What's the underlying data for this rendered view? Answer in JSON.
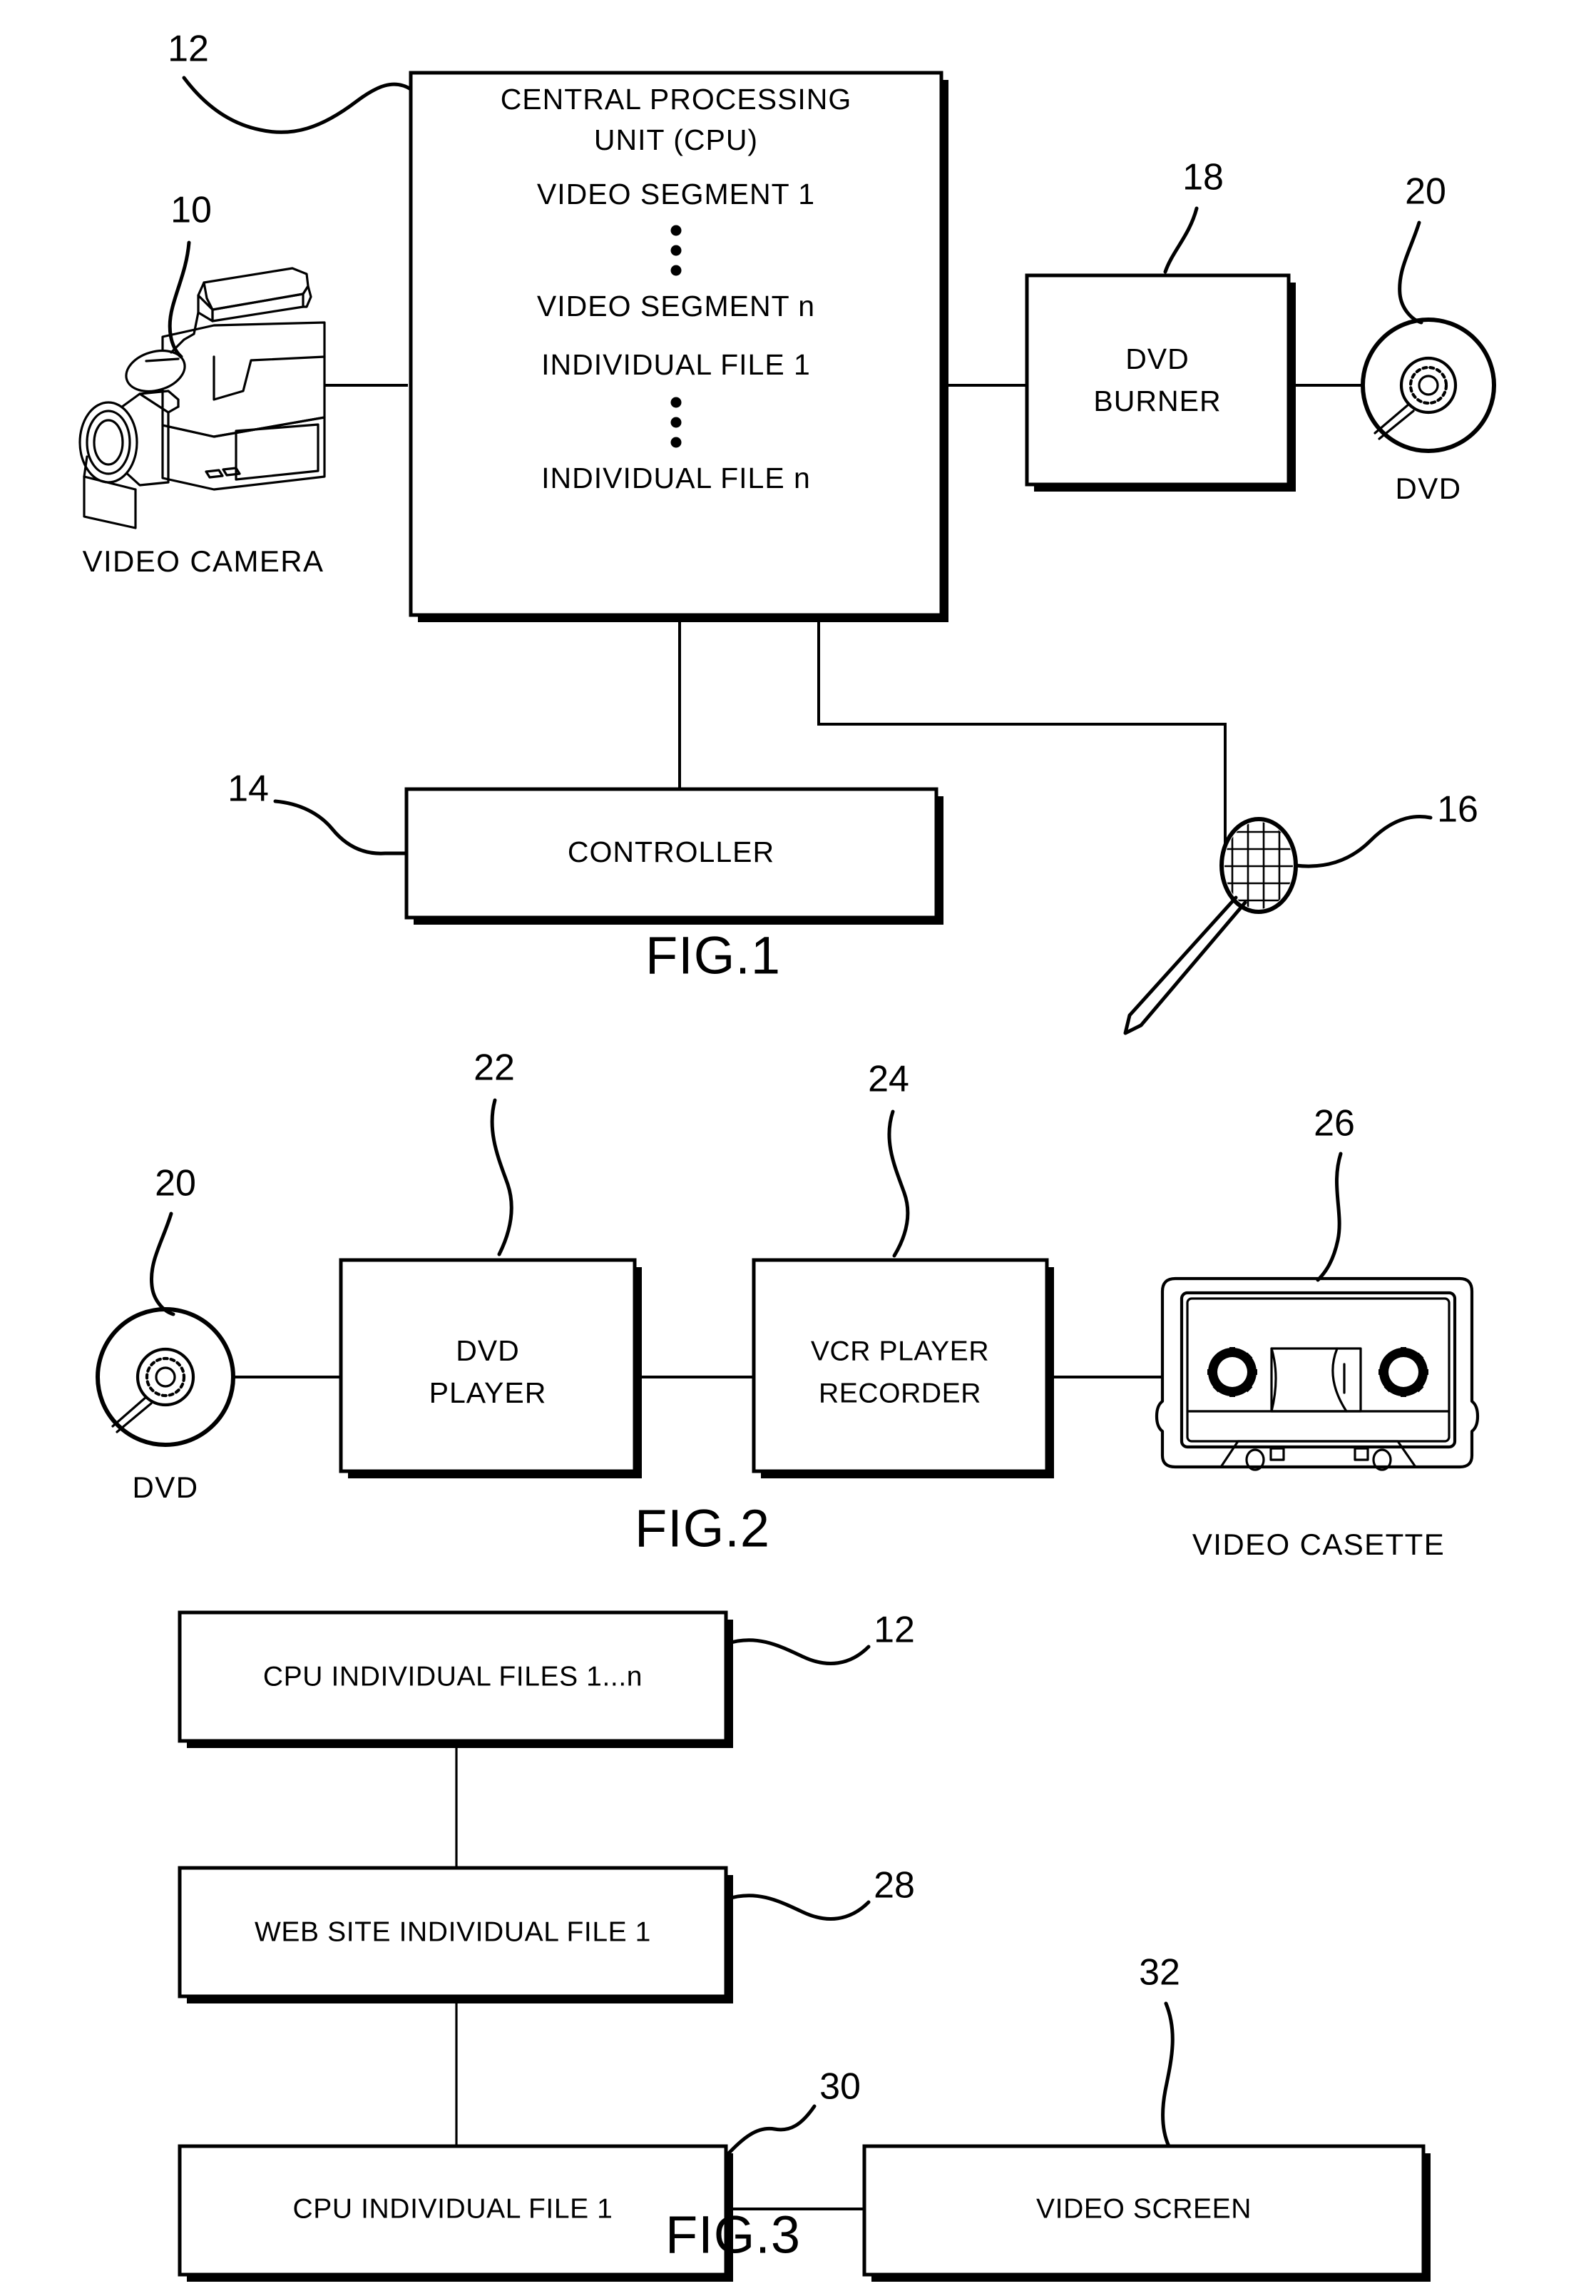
{
  "document": {
    "kind": "patent-drawing-sheet",
    "figure_captions": [
      "FIG.1",
      "FIG.2",
      "FIG.3"
    ]
  },
  "figure1": {
    "caption": "FIG.1",
    "cpu_box": {
      "ref": "12",
      "lines": [
        "CENTRAL PROCESSING",
        "UNIT (CPU)",
        "VIDEO SEGMENT 1",
        "⋮",
        "VIDEO SEGMENT n",
        "INDIVIDUAL FILE 1",
        "⋮",
        "INDIVIDUAL FILE n"
      ],
      "title_line1": "CENTRAL PROCESSING",
      "title_line2": "UNIT (CPU)",
      "item1": "VIDEO SEGMENT 1",
      "item2": "VIDEO SEGMENT n",
      "item3": "INDIVIDUAL FILE 1",
      "item4": "INDIVIDUAL FILE n"
    },
    "camera": {
      "ref": "10",
      "caption": "VIDEO CAMERA"
    },
    "dvd_burner": {
      "ref": "18",
      "line1": "DVD",
      "line2": "BURNER"
    },
    "dvd": {
      "ref": "20",
      "caption": "DVD"
    },
    "controller": {
      "ref": "14",
      "label": "CONTROLLER"
    },
    "microphone": {
      "ref": "16"
    }
  },
  "figure2": {
    "caption": "FIG.2",
    "dvd": {
      "ref": "20",
      "caption": "DVD"
    },
    "dvd_player": {
      "ref": "22",
      "line1": "DVD",
      "line2": "PLAYER"
    },
    "vcr": {
      "ref": "24",
      "line1": "VCR PLAYER",
      "line2": "RECORDER"
    },
    "cassette": {
      "ref": "26",
      "caption": "VIDEO CASETTE"
    }
  },
  "figure3": {
    "caption": "FIG.3",
    "box_cpu_files": {
      "ref": "12",
      "label": "CPU INDIVIDUAL FILES 1...n"
    },
    "box_web_site": {
      "ref": "28",
      "label": "WEB SITE INDIVIDUAL FILE 1"
    },
    "box_cpu_file1": {
      "ref": "30",
      "label": "CPU INDIVIDUAL FILE 1"
    },
    "box_video_screen": {
      "ref": "32",
      "label": "VIDEO SCREEN"
    }
  },
  "colors": {
    "ink": "#000000",
    "paper": "#ffffff"
  }
}
